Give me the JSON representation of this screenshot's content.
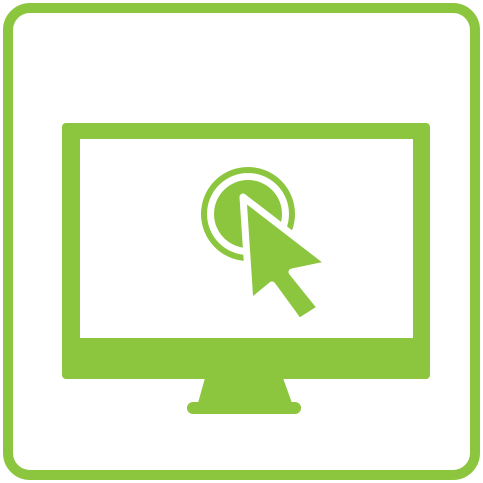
{
  "icon": {
    "name": "computer-click-icon",
    "frame_icon": "rounded-square-frame-icon",
    "monitor_icon": "monitor-icon",
    "click_icon": "click-target-icon",
    "cursor_icon": "arrow-cursor-icon"
  },
  "colors": {
    "accent": "#8cc63f",
    "background": "#ffffff"
  }
}
